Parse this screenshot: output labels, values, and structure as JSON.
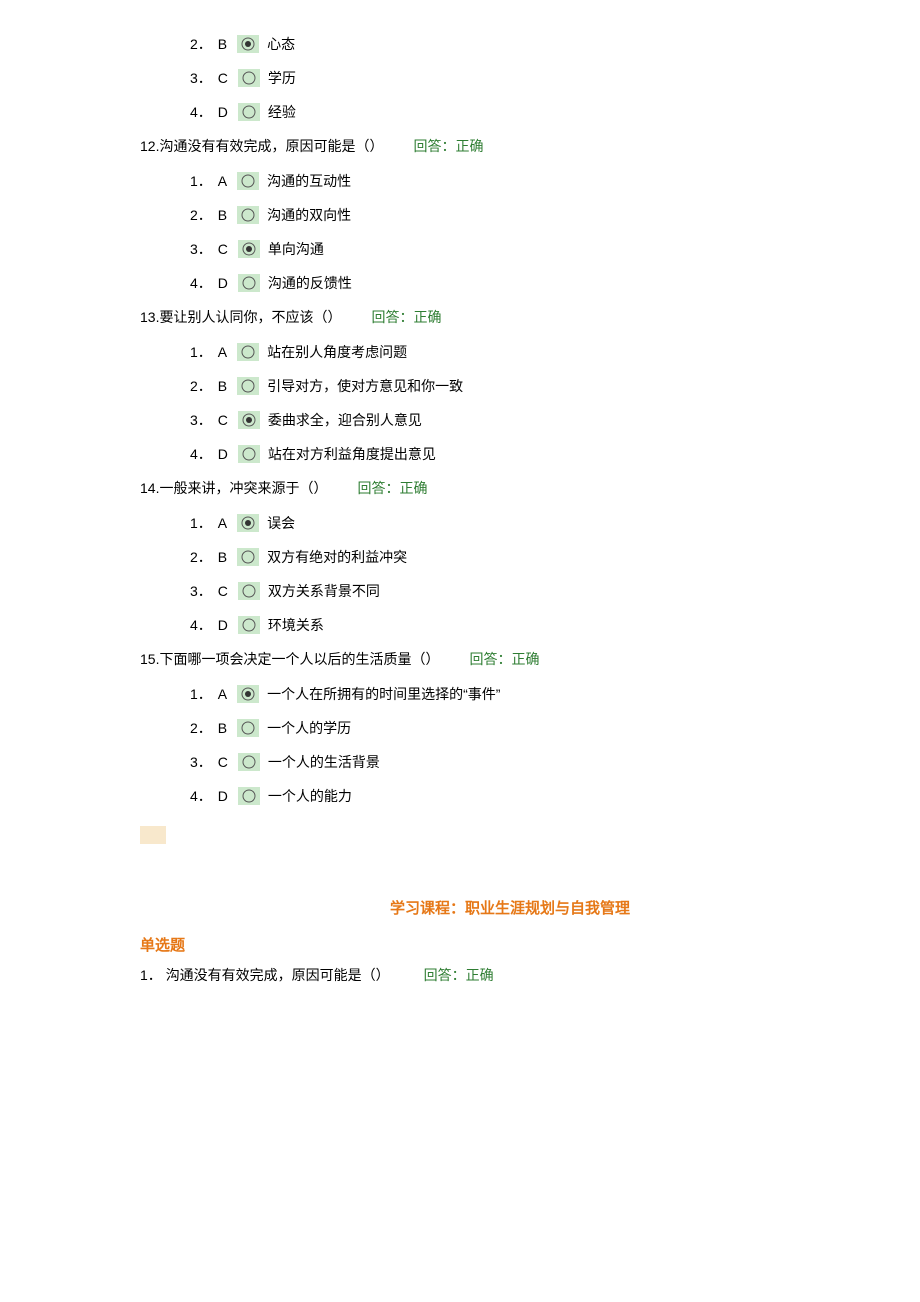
{
  "partial_question_top": {
    "options": [
      {
        "num": "2．",
        "letter": "B",
        "selected": true,
        "text": "心态"
      },
      {
        "num": "3．",
        "letter": "C",
        "selected": false,
        "text": "学历"
      },
      {
        "num": "4．",
        "letter": "D",
        "selected": false,
        "text": "经验"
      }
    ]
  },
  "questions": [
    {
      "num": "12.",
      "text": "沟通没有有效完成，原因可能是（）",
      "answer_label": "回答：正确",
      "options": [
        {
          "num": "1．",
          "letter": "A",
          "selected": false,
          "text": "沟通的互动性"
        },
        {
          "num": "2．",
          "letter": "B",
          "selected": false,
          "text": "沟通的双向性"
        },
        {
          "num": "3．",
          "letter": "C",
          "selected": true,
          "text": "单向沟通"
        },
        {
          "num": "4．",
          "letter": "D",
          "selected": false,
          "text": "沟通的反馈性"
        }
      ]
    },
    {
      "num": "13.",
      "text": "要让别人认同你，不应该（）",
      "answer_label": "回答：正确",
      "options": [
        {
          "num": "1．",
          "letter": "A",
          "selected": false,
          "text": "站在别人角度考虑问题"
        },
        {
          "num": "2．",
          "letter": "B",
          "selected": false,
          "text": "引导对方，使对方意见和你一致"
        },
        {
          "num": "3．",
          "letter": "C",
          "selected": true,
          "text": "委曲求全，迎合别人意见"
        },
        {
          "num": "4．",
          "letter": "D",
          "selected": false,
          "text": "站在对方利益角度提出意见"
        }
      ]
    },
    {
      "num": "14.",
      "text": "一般来讲，冲突来源于（）",
      "answer_label": "回答：正确",
      "options": [
        {
          "num": "1．",
          "letter": "A",
          "selected": true,
          "text": "误会"
        },
        {
          "num": "2．",
          "letter": "B",
          "selected": false,
          "text": "双方有绝对的利益冲突"
        },
        {
          "num": "3．",
          "letter": "C",
          "selected": false,
          "text": "双方关系背景不同"
        },
        {
          "num": "4．",
          "letter": "D",
          "selected": false,
          "text": "环境关系"
        }
      ]
    },
    {
      "num": "15.",
      "text": "下面哪一项会决定一个人以后的生活质量（）",
      "answer_label": "回答：正确",
      "options": [
        {
          "num": "1．",
          "letter": "A",
          "selected": true,
          "text": "一个人在所拥有的时间里选择的“事件”"
        },
        {
          "num": "2．",
          "letter": "B",
          "selected": false,
          "text": "一个人的学历"
        },
        {
          "num": "3．",
          "letter": "C",
          "selected": false,
          "text": "一个人的生活背景"
        },
        {
          "num": "4．",
          "letter": "D",
          "selected": false,
          "text": "一个人的能力"
        }
      ]
    }
  ],
  "course_title": "学习课程：职业生涯规划与自我管理",
  "section_header": "单选题",
  "section2_first": {
    "num": "1．",
    "text": "沟通没有有效完成，原因可能是（）",
    "answer_label": "回答：正确"
  }
}
